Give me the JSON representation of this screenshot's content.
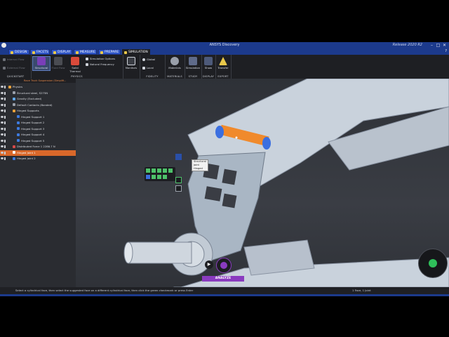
{
  "titlebar": {
    "title": "ANSYS Discovery",
    "release": "Release 2020 R2",
    "minimize": "–",
    "maximize": "□",
    "close": "✕"
  },
  "tabs": [
    {
      "label": "Design"
    },
    {
      "label": "Facets"
    },
    {
      "label": "Display"
    },
    {
      "label": "Measure"
    },
    {
      "label": "Prepare"
    },
    {
      "label": "Simulation"
    }
  ],
  "ribbon": {
    "flow": {
      "internal_flow": "Internal Flow",
      "external_flow": "External Flow",
      "label": "Quickstart"
    },
    "physics": {
      "structural": "Structural",
      "fluid_flow": "Fluid Flow",
      "solid_thermal": "Solid Thermal",
      "simulation_options": "Simulation Options",
      "natural_frequency": "Natural Frequency",
      "label": "Physics"
    },
    "monitors": {
      "label": "Monitors"
    },
    "fidelity": {
      "global": "Global",
      "local": "Local",
      "label": "Fidelity"
    },
    "materials": {
      "label": "Materials",
      "group": "Materials"
    },
    "study": {
      "simulation": "Simulation",
      "label": "Study"
    },
    "display": {
      "show": "Show",
      "label": "Display"
    },
    "export": {
      "transfer": "Transfer",
      "label": "Export"
    }
  },
  "panel": {
    "header": "Race Truck Suspension (Simplifi...",
    "tree": [
      {
        "label": "Physics",
        "level": 0,
        "color": "#e9a13b"
      },
      {
        "label": "Structural steel, S275N",
        "level": 1,
        "color": "#9aa0aa"
      },
      {
        "label": "Gravity  (Excluded)",
        "level": 1,
        "color": "#5fa7e8"
      },
      {
        "label": "Default Contacts (Bonded)",
        "level": 1,
        "color": "#9aa0aa"
      },
      {
        "label": "Hinged Supports",
        "level": 1,
        "color": "#e9a13b"
      },
      {
        "label": "Hinged Support 1",
        "level": 2,
        "color": "#3d7be0"
      },
      {
        "label": "Hinged Support 2",
        "level": 2,
        "color": "#3d7be0"
      },
      {
        "label": "Hinged Support 3",
        "level": 2,
        "color": "#3d7be0"
      },
      {
        "label": "Hinged Support 4",
        "level": 2,
        "color": "#3d7be0"
      },
      {
        "label": "Hinged Support 5",
        "level": 2,
        "color": "#3d7be0"
      },
      {
        "label": "Distributed Force 1     2286.7 N",
        "level": 1,
        "color": "#d94a4a"
      },
      {
        "label": "Hinged Joint 1",
        "level": 1,
        "color": "#ffffff",
        "selected": true
      },
      {
        "label": "Hinged Joint 2",
        "level": 1,
        "color": "#3d7be0"
      }
    ]
  },
  "viewport": {
    "tooltip_lines": [
      "Structural",
      "Joint",
      "Hinged"
    ],
    "analyze_label": "ANALYZE"
  },
  "status": {
    "message": "Select a cylindrical face, then select the suggested face on a different cylindrical face, then click the green checkmark or press Enter",
    "selection": "1 Face, 1 Joint"
  },
  "colors": {
    "accent_blue": "#1c3a8c",
    "selection_orange": "#d9682a",
    "joint_orange": "#f08a2c",
    "analyze_purple": "#8a3bbf"
  }
}
